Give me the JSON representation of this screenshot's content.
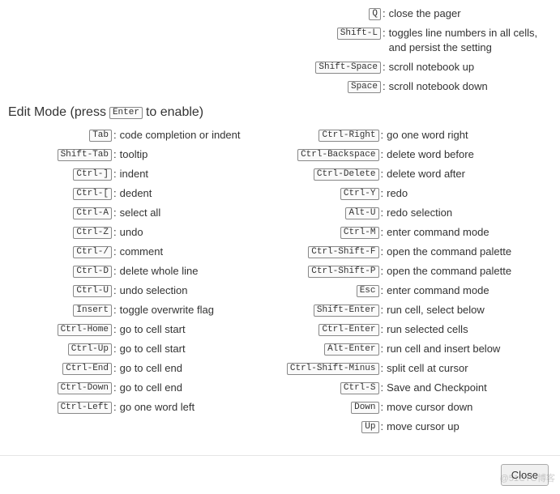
{
  "top_shortcuts": [
    {
      "key": "Q",
      "desc": "close the pager"
    },
    {
      "key": "Shift-L",
      "desc": "toggles line numbers in all cells, and persist the setting"
    },
    {
      "key": "Shift-Space",
      "desc": "scroll notebook up"
    },
    {
      "key": "Space",
      "desc": "scroll notebook down"
    }
  ],
  "edit_mode": {
    "title_prefix": "Edit Mode (press ",
    "title_key": "Enter",
    "title_suffix": " to enable)",
    "left": [
      {
        "key": "Tab",
        "desc": "code completion or indent"
      },
      {
        "key": "Shift-Tab",
        "desc": "tooltip"
      },
      {
        "key": "Ctrl-]",
        "desc": "indent"
      },
      {
        "key": "Ctrl-[",
        "desc": "dedent"
      },
      {
        "key": "Ctrl-A",
        "desc": "select all"
      },
      {
        "key": "Ctrl-Z",
        "desc": "undo"
      },
      {
        "key": "Ctrl-/",
        "desc": "comment"
      },
      {
        "key": "Ctrl-D",
        "desc": "delete whole line"
      },
      {
        "key": "Ctrl-U",
        "desc": "undo selection"
      },
      {
        "key": "Insert",
        "desc": "toggle overwrite flag"
      },
      {
        "key": "Ctrl-Home",
        "desc": "go to cell start"
      },
      {
        "key": "Ctrl-Up",
        "desc": "go to cell start"
      },
      {
        "key": "Ctrl-End",
        "desc": "go to cell end"
      },
      {
        "key": "Ctrl-Down",
        "desc": "go to cell end"
      },
      {
        "key": "Ctrl-Left",
        "desc": "go one word left"
      }
    ],
    "right": [
      {
        "key": "Ctrl-Right",
        "desc": "go one word right"
      },
      {
        "key": "Ctrl-Backspace",
        "desc": "delete word before"
      },
      {
        "key": "Ctrl-Delete",
        "desc": "delete word after"
      },
      {
        "key": "Ctrl-Y",
        "desc": "redo"
      },
      {
        "key": "Alt-U",
        "desc": "redo selection"
      },
      {
        "key": "Ctrl-M",
        "desc": "enter command mode"
      },
      {
        "key": "Ctrl-Shift-F",
        "desc": "open the command palette"
      },
      {
        "key": "Ctrl-Shift-P",
        "desc": "open the command palette"
      },
      {
        "key": "Esc",
        "desc": "enter command mode"
      },
      {
        "key": "Shift-Enter",
        "desc": "run cell, select below"
      },
      {
        "key": "Ctrl-Enter",
        "desc": "run selected cells"
      },
      {
        "key": "Alt-Enter",
        "desc": "run cell and insert below"
      },
      {
        "key": "Ctrl-Shift-Minus",
        "desc": "split cell at cursor"
      },
      {
        "key": "Ctrl-S",
        "desc": "Save and Checkpoint"
      },
      {
        "key": "Down",
        "desc": "move cursor down"
      },
      {
        "key": "Up",
        "desc": "move cursor up"
      }
    ]
  },
  "footer": {
    "close_label": "Close"
  },
  "watermark": "@51CTO博客"
}
